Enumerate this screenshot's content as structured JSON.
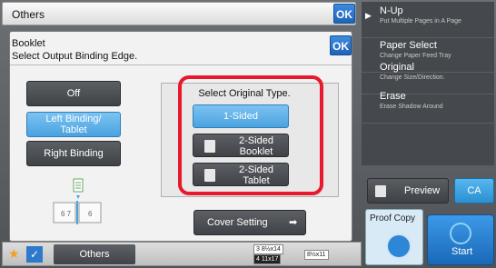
{
  "top_bar": {
    "title": "Others",
    "ok_label": "OK"
  },
  "dialog": {
    "title_line1": "Booklet",
    "title_line2": "Select Output Binding Edge.",
    "ok_label": "OK",
    "binding_options": [
      {
        "label": "Off",
        "selected": false
      },
      {
        "label_line1": "Left Binding/",
        "label_line2": "Tablet",
        "selected": true
      },
      {
        "label": "Right Binding",
        "selected": false
      }
    ],
    "original_type": {
      "label": "Select Original Type.",
      "options": [
        {
          "label": "1-Sided",
          "selected": true
        },
        {
          "label_line1": "2-Sided",
          "label_line2": "Booklet",
          "selected": false,
          "icon": "booklet-icon"
        },
        {
          "label_line1": "2-Sided",
          "label_line2": "Tablet",
          "selected": false,
          "icon": "tablet-icon"
        }
      ]
    },
    "cover_setting_label": "Cover Setting"
  },
  "right_panel": {
    "items": [
      {
        "title": "N-Up",
        "subtitle": "Put Multiple Pages in A Page"
      },
      {
        "title": "Paper Select",
        "subtitle": "Change Paper Feed Tray"
      },
      {
        "title": "Original",
        "subtitle": "Change Size/Direction."
      },
      {
        "title": "Erase",
        "subtitle": "Erase Shadow Around"
      }
    ]
  },
  "actions": {
    "preview_label": "Preview",
    "ca_label": "CA",
    "proof_copy_label": "Proof Copy",
    "start_label": "Start"
  },
  "bottom_bar": {
    "others_label": "Others",
    "paper_sizes": [
      {
        "num": "3",
        "size": "8½x14"
      },
      {
        "num": "4",
        "size": "11x17",
        "selected": true
      },
      {
        "size": "8½x11"
      }
    ]
  },
  "colors": {
    "accent_blue": "#2e79c9",
    "selected_blue": "#6ab8ee",
    "highlight_red": "#e8192c",
    "star": "#f0a020"
  }
}
